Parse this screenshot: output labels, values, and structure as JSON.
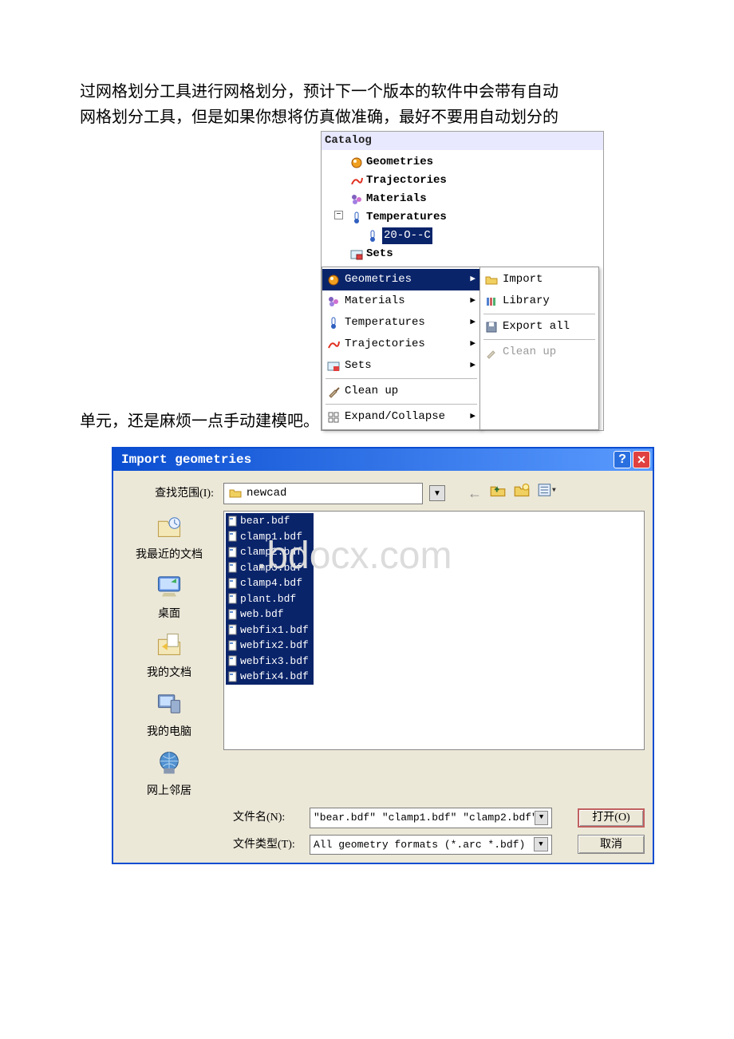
{
  "body": {
    "para1_line1": "过网格划分工具进行网格划分，预计下一个版本的软件中会带有自动",
    "para1_line2": "网格划分工具，但是如果你想将仿真做准确，最好不要用自动划分的",
    "para2": "单元，还是麻烦一点手动建模吧。"
  },
  "catalog": {
    "title": "Catalog",
    "tree": {
      "geometries": "Geometries",
      "trajectories": "Trajectories",
      "materials": "Materials",
      "temperatures": "Temperatures",
      "temp_child": "20-O--C",
      "sets": "Sets"
    },
    "menu": {
      "geometries": "Geometries",
      "materials": "Materials",
      "temperatures": "Temperatures",
      "trajectories": "Trajectories",
      "sets": "Sets",
      "cleanup": "Clean up",
      "expand": "Expand/Collapse"
    },
    "submenu": {
      "import": "Import",
      "library": "Library",
      "export_all": "Export all",
      "cleanup": "Clean up"
    }
  },
  "dialog": {
    "title": "Import geometries",
    "lookin_label": "查找范围(I):",
    "folder": "newcad",
    "places": {
      "recent": "我最近的文档",
      "desktop": "桌面",
      "docs": "我的文档",
      "computer": "我的电脑",
      "network": "网上邻居"
    },
    "files": [
      "bear.bdf",
      "clamp1.bdf",
      "clamp2.bdf",
      "clamp3.bdf",
      "clamp4.bdf",
      "plant.bdf",
      "web.bdf",
      "webfix1.bdf",
      "webfix2.bdf",
      "webfix3.bdf",
      "webfix4.bdf"
    ],
    "filename_label": "文件名(N):",
    "filename_value": "\"bear.bdf\" \"clamp1.bdf\" \"clamp2.bdf\" \"",
    "filetype_label": "文件类型(T):",
    "filetype_value": "All geometry formats (*.arc *.bdf)",
    "open_btn": "打开(O)",
    "cancel_btn": "取消"
  },
  "watermark": ".bdocx.com"
}
